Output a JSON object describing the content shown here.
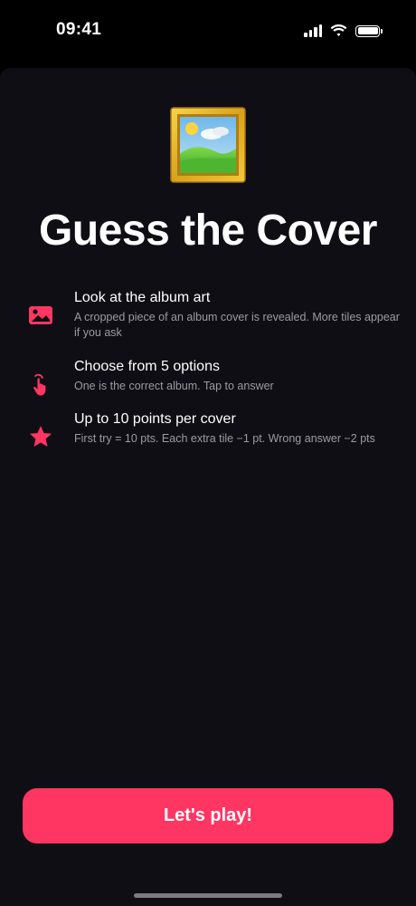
{
  "status_bar": {
    "time": "09:41",
    "signal_icon": "cellular-signal-icon",
    "wifi_icon": "wifi-icon",
    "battery_icon": "battery-icon"
  },
  "hero": {
    "emoji": "framed-picture-emoji",
    "title": "Guess the Cover"
  },
  "features": [
    {
      "icon": "image-icon",
      "title": "Look at the album art",
      "description": "A cropped piece of an album cover is revealed. More tiles appear if you ask"
    },
    {
      "icon": "tap-hand-icon",
      "title": "Choose from 5 options",
      "description": "One is the correct album. Tap to answer"
    },
    {
      "icon": "star-icon",
      "title": "Up to 10 points per cover",
      "description": "First try = 10 pts. Each extra tile −1 pt. Wrong answer −2 pts"
    }
  ],
  "cta": {
    "label": "Let's play!"
  },
  "colors": {
    "accent": "#ff3562",
    "background": "#0f0e14",
    "secondary_text": "#9c9aa4"
  }
}
